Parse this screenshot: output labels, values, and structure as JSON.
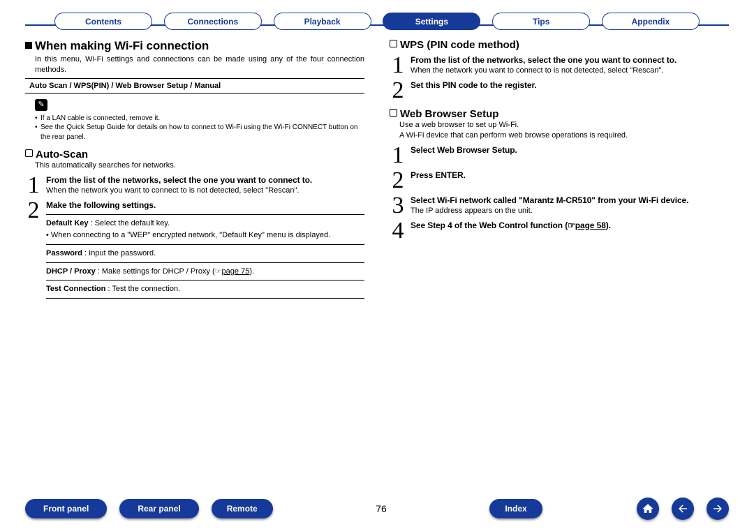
{
  "tabs": [
    "Contents",
    "Connections",
    "Playback",
    "Settings",
    "Tips",
    "Appendix"
  ],
  "active_tab": 3,
  "page_number": "76",
  "left": {
    "heading": "When making Wi-Fi connection",
    "intro": "In this menu, Wi-Fi settings and connections can be made using any of the four connection methods.",
    "methods": "Auto Scan / WPS(PIN) / Web Browser Setup / Manual",
    "note_icon": "✎",
    "notes": [
      "If a LAN cable is connected, remove it.",
      "See the Quick Setup Guide for details on how to connect to Wi-Fi using the Wi-Fi CONNECT button on the rear panel."
    ],
    "autoscan_heading": "Auto-Scan",
    "autoscan_desc": "This automatically searches for networks.",
    "step1_title": "From the list of the networks, select the one you want to connect to.",
    "step1_body": "When the network you want to connect to is not detected, select \"Rescan\".",
    "step2_title": "Make the following settings.",
    "settings": [
      {
        "k": "Default Key",
        "v": " : Select the default key.",
        "extra": "• When connecting to a \"WEP\" encrypted network, \"Default Key\" menu is displayed."
      },
      {
        "k": "Password",
        "v": " : Input the password."
      },
      {
        "k": "DHCP / Proxy",
        "v": " : Make settings for DHCP / Proxy (☞",
        "link": "page 75",
        "tail": ")."
      },
      {
        "k": "Test Connection",
        "v": " : Test the connection."
      }
    ]
  },
  "right": {
    "wps_heading": "WPS (PIN code method)",
    "wps_step1_title": "From the list of the networks, select the one you want to connect to.",
    "wps_step1_body": "When the network you want to connect to is not detected, select \"Rescan\".",
    "wps_step2_title": "Set this PIN code to the register.",
    "web_heading": "Web Browser Setup",
    "web_intro1": "Use a web browser to set up Wi-Fi.",
    "web_intro2": "A Wi-Fi device that can perform web browse operations is required.",
    "wstep1": "Select Web Browser Setup.",
    "wstep2": "Press ENTER.",
    "wstep3": "Select Wi-Fi network called \"Marantz M-CR510\" from your Wi-Fi device.",
    "wstep3_body": "The IP address appears on the unit.",
    "wstep4_pre": "See Step 4 of the Web Control function (☞",
    "wstep4_link": "page 58",
    "wstep4_post": ")."
  },
  "bottom_left": [
    "Front panel",
    "Rear panel",
    "Remote"
  ],
  "bottom_mid": "Index",
  "icons": {
    "home": "home-icon",
    "back": "arrow-left-icon",
    "fwd": "arrow-right-icon"
  }
}
